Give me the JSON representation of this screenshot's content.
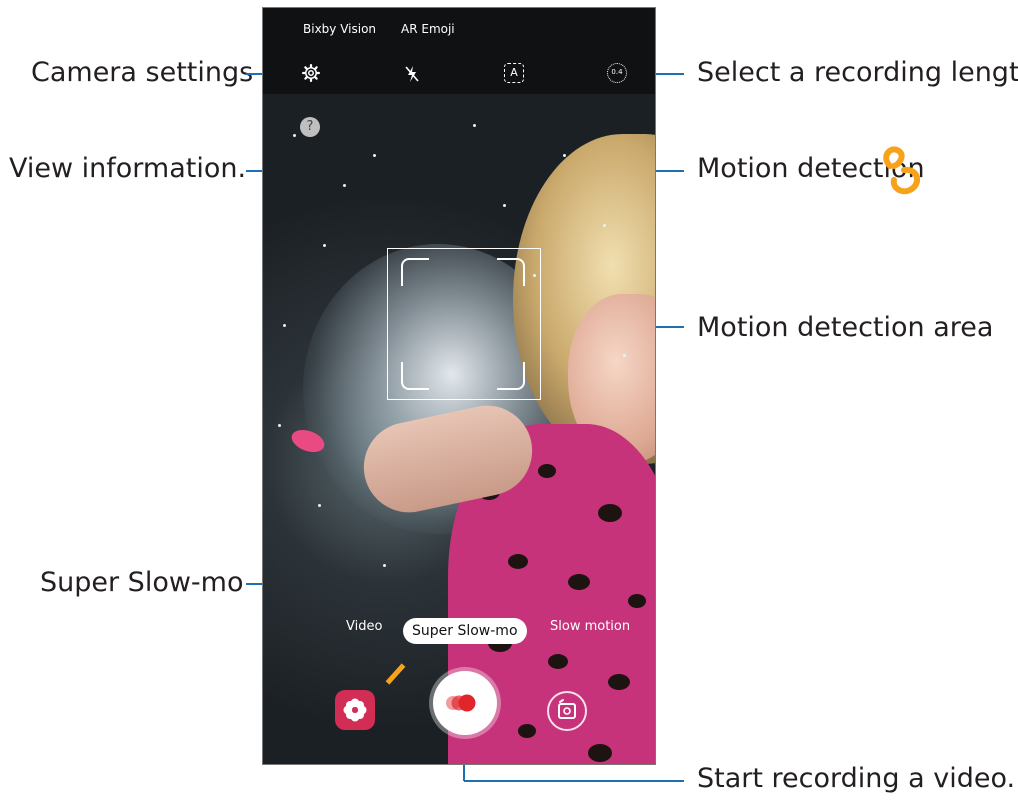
{
  "topbar": {
    "menu_items": [
      "Bixby Vision",
      "AR Emoji"
    ],
    "icons": [
      "settings-gear-icon",
      "flash-off-icon",
      "auto-motion-detection-icon",
      "recording-length-icon"
    ],
    "recording_length_value": "0.4",
    "auto_icon_letter": "A"
  },
  "camera": {
    "help_label": "?",
    "modes": [
      "Video",
      "Super Slow-mo",
      "Slow motion"
    ],
    "active_mode": "Super Slow-mo"
  },
  "callouts": {
    "camera_settings": "Camera settings",
    "view_information": "View information.",
    "select_recording_length": "Select a recording length.",
    "motion_detection": "Motion detection",
    "motion_detection_area": "Motion detection area",
    "super_slow_mo": "Super Slow-mo",
    "start_recording": "Start recording a video."
  },
  "colors": {
    "callout_line": "#1f6fb3",
    "record_accent": "#e0262b",
    "bixby_button": "#d12d55",
    "suit_pink": "#c6337a",
    "annotation_orange": "#f7a21b"
  }
}
